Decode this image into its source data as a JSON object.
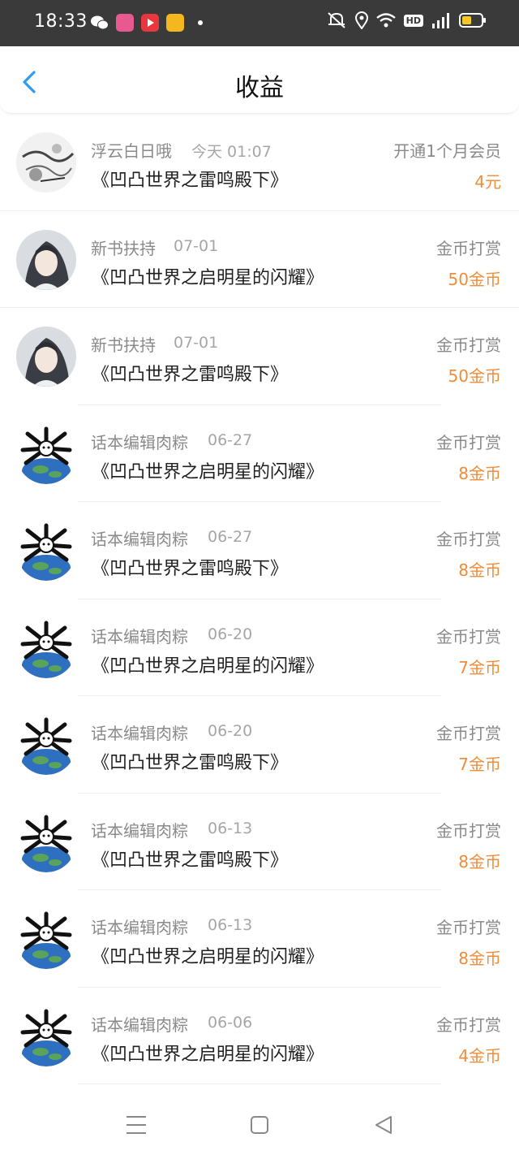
{
  "status_bar": {
    "time": "18:33",
    "icons": [
      "wechat-icon",
      "bilibili-icon",
      "video-app-icon",
      "weibo-icon",
      "notification-dot",
      "mute-icon",
      "location-icon",
      "wifi-icon",
      "hd-icon",
      "signal-4g-icon",
      "battery-icon"
    ],
    "hd": "HD"
  },
  "header": {
    "title": "收益",
    "back_icon": "chevron-left-icon",
    "accent": "#2f9bf0"
  },
  "colors": {
    "amount": "#f08c3a",
    "secondary_text": "#8a8a8a"
  },
  "rows": [
    {
      "name": "浮云白日哦",
      "time": "今天 01:07",
      "book": "《凹凸世界之雷鸣殿下》",
      "type": "开通1个月会员",
      "amount": "4元",
      "avatar": "manga-art-avatar"
    },
    {
      "name": "新书扶持",
      "time": "07-01",
      "book": "《凹凸世界之启明星的闪耀》",
      "type": "金币打赏",
      "amount": "50金币",
      "avatar": "anime-character-avatar"
    },
    {
      "name": "新书扶持",
      "time": "07-01",
      "book": "《凹凸世界之雷鸣殿下》",
      "type": "金币打赏",
      "amount": "50金币",
      "avatar": "anime-character-avatar"
    },
    {
      "name": "话本编辑肉粽",
      "time": "06-27",
      "book": "《凹凸世界之启明星的闪耀》",
      "type": "金币打赏",
      "amount": "8金币",
      "avatar": "panda-earth-avatar"
    },
    {
      "name": "话本编辑肉粽",
      "time": "06-27",
      "book": "《凹凸世界之雷鸣殿下》",
      "type": "金币打赏",
      "amount": "8金币",
      "avatar": "panda-earth-avatar"
    },
    {
      "name": "话本编辑肉粽",
      "time": "06-20",
      "book": "《凹凸世界之启明星的闪耀》",
      "type": "金币打赏",
      "amount": "7金币",
      "avatar": "panda-earth-avatar"
    },
    {
      "name": "话本编辑肉粽",
      "time": "06-20",
      "book": "《凹凸世界之雷鸣殿下》",
      "type": "金币打赏",
      "amount": "7金币",
      "avatar": "panda-earth-avatar"
    },
    {
      "name": "话本编辑肉粽",
      "time": "06-13",
      "book": "《凹凸世界之雷鸣殿下》",
      "type": "金币打赏",
      "amount": "8金币",
      "avatar": "panda-earth-avatar"
    },
    {
      "name": "话本编辑肉粽",
      "time": "06-13",
      "book": "《凹凸世界之启明星的闪耀》",
      "type": "金币打赏",
      "amount": "8金币",
      "avatar": "panda-earth-avatar"
    },
    {
      "name": "话本编辑肉粽",
      "time": "06-06",
      "book": "《凹凸世界之启明星的闪耀》",
      "type": "金币打赏",
      "amount": "4金币",
      "avatar": "panda-earth-avatar"
    }
  ],
  "nav": {
    "icons": [
      "menu-icon",
      "home-square-icon",
      "back-triangle-icon"
    ]
  }
}
